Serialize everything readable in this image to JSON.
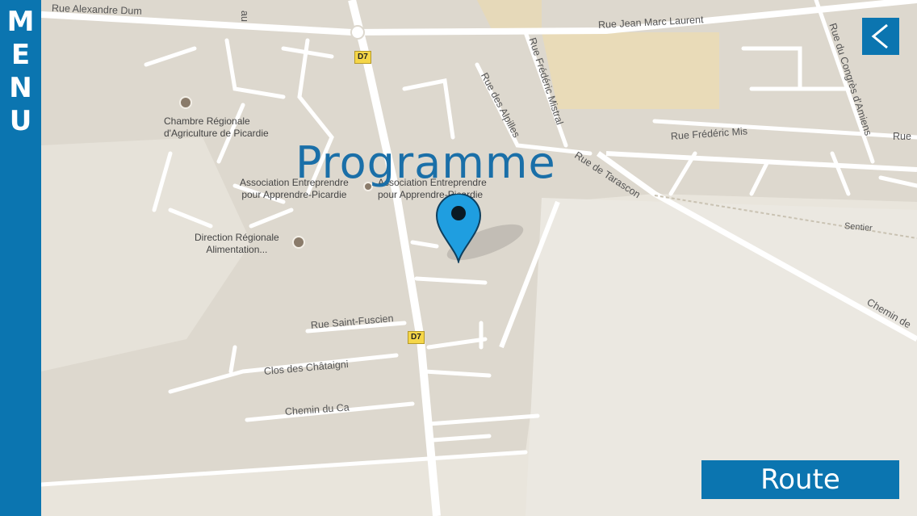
{
  "sidebar": {
    "letters": [
      "M",
      "E",
      "N",
      "U"
    ]
  },
  "title": "Programme",
  "back_button": {
    "label": "<"
  },
  "route_button": {
    "label": "Route"
  },
  "map": {
    "pois": [
      {
        "name": "Chambre Régionale\nd'Agriculture de Picardie"
      },
      {
        "name": "Association Entreprendre\npour Apprendre-Picardie"
      },
      {
        "name": "Association Entreprendre\npour Apprendre-Picardie"
      },
      {
        "name": "Direction Régionale\nAlimentation..."
      }
    ],
    "streets": [
      "Rue Alexandre Dum",
      "Rue Jean Marc Laurent",
      "Rue Frédéric Mistral",
      "Rue des Alpilles",
      "Rue du Congrès d'Amiens",
      "Rue Frédéric Mis",
      "Rue",
      "Rue de Tarascon",
      "Sentier",
      "Chemin de",
      "Rue Saint-Fuscien",
      "Clos des Châtaigni",
      "Chemin du Ca",
      "au"
    ],
    "road_badges": [
      "D7",
      "D7"
    ],
    "marker": "location-pin"
  },
  "colors": {
    "accent": "#0b75b0",
    "title": "#1a6fa8",
    "pin": "#1f9ee0",
    "map_bg": "#e9e5dc"
  }
}
